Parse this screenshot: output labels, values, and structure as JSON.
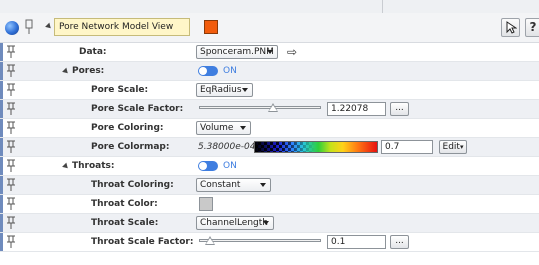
{
  "header": {
    "title": "Pore Network Model View",
    "accent_color": "#f25c0c",
    "icons": [
      "globe-icon",
      "pin-icon",
      "collapse-triangle-icon",
      "cursor-icon",
      "help-icon"
    ],
    "help_label": "?"
  },
  "rows": {
    "data": {
      "label": "Data:",
      "value": "Sponceram.PNM"
    },
    "pores": {
      "label": "Pores:",
      "toggle": "ON"
    },
    "pore_scale": {
      "label": "Pore Scale:",
      "value": "EqRadius"
    },
    "pore_scale_factor": {
      "label": "Pore Scale Factor:",
      "value": "1.22078",
      "slider_fraction": 0.35,
      "button": "..."
    },
    "pore_coloring": {
      "label": "Pore Coloring:",
      "value": "Volume"
    },
    "pore_colormap": {
      "label": "Pore Colormap:",
      "min": "5.38000e-04",
      "max": "0.7",
      "edit": "Edit"
    },
    "throats": {
      "label": "Throats:",
      "toggle": "ON"
    },
    "throat_coloring": {
      "label": "Throat Coloring:",
      "value": "Constant"
    },
    "throat_color": {
      "label": "Throat Color:",
      "swatch": "#c9c9c9"
    },
    "throat_scale": {
      "label": "Throat Scale:",
      "value": "ChannelLength"
    },
    "throat_scale_factor": {
      "label": "Throat Scale Factor:",
      "value": "0.1",
      "slider_fraction": 0.05,
      "button": "..."
    }
  }
}
